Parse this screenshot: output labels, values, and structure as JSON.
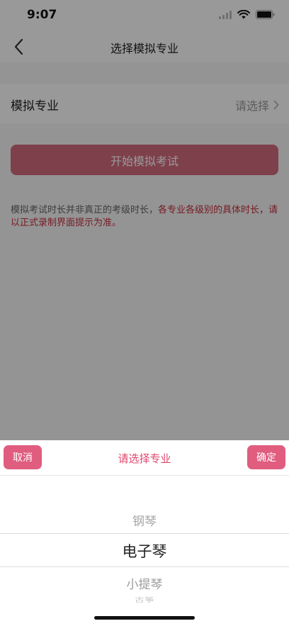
{
  "status_bar": {
    "time": "9:07"
  },
  "nav": {
    "title": "选择模拟专业"
  },
  "form": {
    "major_label": "模拟专业",
    "major_value": "请选择"
  },
  "start_button_label": "开始模拟考试",
  "notice": {
    "normal_text": "模拟考试时长并非真正的考级时长，",
    "highlight_text": "各专业各级别的具体时长，请以正式录制界面提示为准。"
  },
  "picker": {
    "cancel_label": "取消",
    "title": "请选择专业",
    "confirm_label": "确定",
    "options": [
      "钢琴",
      "电子琴",
      "小提琴",
      "古筝"
    ],
    "selected_option": "电子琴"
  },
  "colors": {
    "accent": "#e05d7f",
    "title_accent": "#e0466c",
    "notice_highlight": "#c72e3f"
  }
}
